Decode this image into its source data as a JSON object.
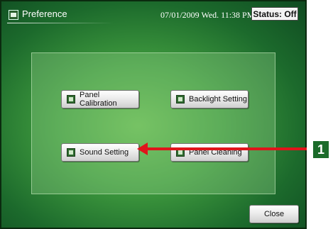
{
  "window": {
    "title": "Preference",
    "datetime": "07/01/2009 Wed. 11:38 PM",
    "status": "Status: Off"
  },
  "buttons": {
    "panel_calibration": "Panel Calibration",
    "backlight_setting": "Backlight Setting",
    "sound_setting": "Sound Setting",
    "panel_cleaning": "Panel Cleaning",
    "close": "Close"
  },
  "callout": {
    "number": "1",
    "color": "#e0141b"
  },
  "icons": {
    "title": "preference-icon",
    "panel_calibration": "calibration-icon",
    "backlight_setting": "backlight-icon",
    "sound_setting": "speaker-icon",
    "panel_cleaning": "cleaning-icon"
  }
}
